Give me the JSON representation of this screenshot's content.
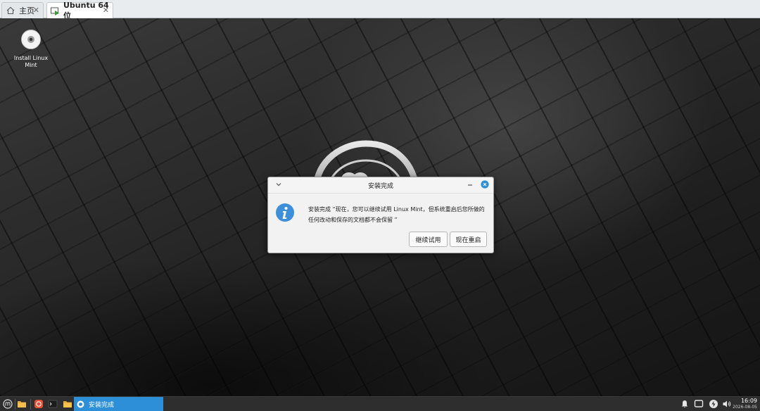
{
  "host_tabs": [
    {
      "label": "主页",
      "icon": "home-icon",
      "active": false
    },
    {
      "label": "Ubuntu 64 位",
      "icon": "vm-icon",
      "active": true
    }
  ],
  "desktop": {
    "icons": [
      {
        "label_line1": "Install Linux",
        "label_line2": "Mint",
        "icon": "disc-icon"
      }
    ]
  },
  "dialog": {
    "title": "安装完成",
    "message_line1": "安装完成 “现在，您可以继续试用 Linux Mint，但系统重启后您所做的",
    "message_line2": "任何改动和保存的文档都不会保留 ”",
    "buttons": {
      "continue": "继续试用",
      "restart": "现在重启"
    },
    "icon": "info-icon"
  },
  "taskbar": {
    "launchers": [
      "mint-menu-icon",
      "files-icon",
      "software-manager-icon",
      "terminal-icon",
      "folder-icon"
    ],
    "window_item": {
      "label": "安装完成",
      "icon": "installer-icon"
    },
    "tray": [
      "notification-icon",
      "display-icon",
      "network-icon",
      "volume-icon"
    ],
    "time": "16:09",
    "date": "2026-08-05"
  },
  "colors": {
    "accent": "#2d8fd8",
    "info_blue": "#3d8fd9",
    "close_blue": "#2c8ed8"
  }
}
